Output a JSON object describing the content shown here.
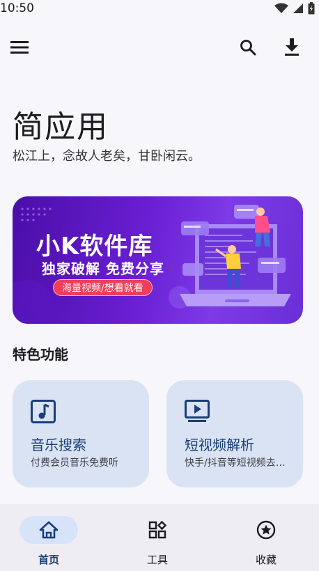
{
  "status_bar": {
    "time": "10:50"
  },
  "toolbar": {
    "menu_icon": "menu-icon",
    "search_icon": "search-icon",
    "download_icon": "download-icon"
  },
  "app": {
    "title": "简应用",
    "subtitle": "松江上，念故人老矣，甘卧闲云。"
  },
  "banner": {
    "title": "小K软件库",
    "subtitle": "独家破解 免费分享",
    "pill": "海量视频/想看就看"
  },
  "features": {
    "title": "特色功能",
    "cards": [
      {
        "title": "音乐搜索",
        "desc": "付费会员音乐免费听",
        "icon": "music-note-icon"
      },
      {
        "title": "短视频解析",
        "desc": "快手/抖音等短视频去水印",
        "icon": "video-play-icon"
      }
    ]
  },
  "bottom_nav": [
    {
      "label": "首页",
      "icon": "home-icon",
      "active": true
    },
    {
      "label": "工具",
      "icon": "tools-grid-icon",
      "active": false
    },
    {
      "label": "收藏",
      "icon": "star-icon",
      "active": false
    }
  ],
  "colors": {
    "accent": "#1a3e78",
    "card_bg": "#d9e3f4",
    "nav_pill": "#d7e3f8",
    "banner": "#6a1fd3"
  }
}
